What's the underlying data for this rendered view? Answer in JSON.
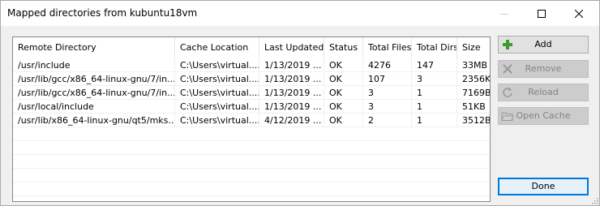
{
  "window": {
    "title": "Mapped directories from kubuntu18vm"
  },
  "table": {
    "columns": [
      "Remote Directory",
      "Cache Location",
      "Last Updated",
      "Status",
      "Total Files",
      "Total Dirs",
      "Size"
    ],
    "rows": [
      [
        "/usr/include",
        "C:\\Users\\virtual....",
        "1/13/2019 ...",
        "OK",
        "4276",
        "147",
        "33MB"
      ],
      [
        "/usr/lib/gcc/x86_64-linux-gnu/7/in...",
        "C:\\Users\\virtual....",
        "1/13/2019 ...",
        "OK",
        "107",
        "3",
        "2356KB"
      ],
      [
        "/usr/lib/gcc/x86_64-linux-gnu/7/in...",
        "C:\\Users\\virtual....",
        "1/13/2019 ...",
        "OK",
        "3",
        "1",
        "7169B"
      ],
      [
        "/usr/local/include",
        "C:\\Users\\virtual....",
        "1/13/2019 ...",
        "OK",
        "3",
        "1",
        "51KB"
      ],
      [
        "/usr/lib/x86_64-linux-gnu/qt5/mks...",
        "C:\\Users\\virtual....",
        "4/12/2019 ...",
        "OK",
        "2",
        "1",
        "3512B"
      ]
    ]
  },
  "buttons": {
    "add": "Add",
    "remove": "Remove",
    "reload": "Reload",
    "open_cache": "Open Cache",
    "done": "Done"
  },
  "colors": {
    "accent": "#0078d7",
    "add_icon": "#3c9a2e"
  }
}
